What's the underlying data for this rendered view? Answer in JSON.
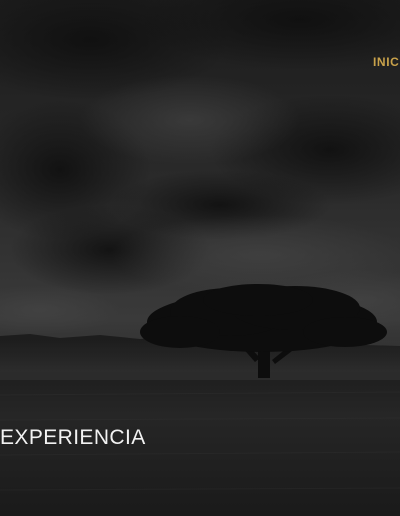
{
  "nav": {
    "items": [
      {
        "label": "INICIO"
      }
    ]
  },
  "hero": {
    "heading": "EXPERIENCIA",
    "background": "tree-landscape-photo"
  },
  "colors": {
    "nav_accent": "#c9a24a",
    "heading": "#f2f2f2",
    "background": "#141414"
  }
}
